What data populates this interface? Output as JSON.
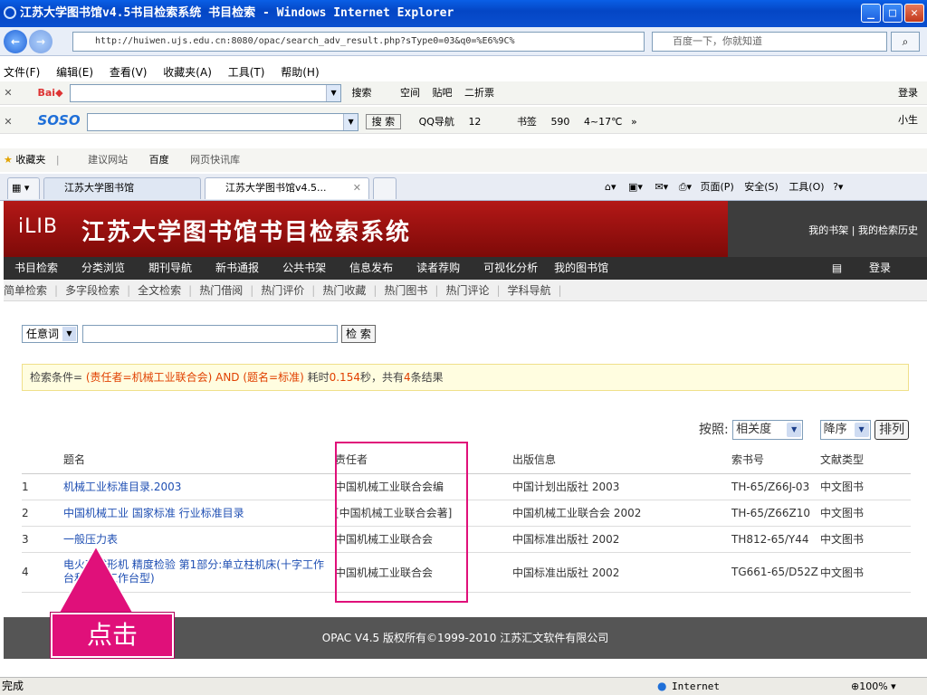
{
  "window": {
    "title": "江苏大学图书馆v4.5书目检索系统 书目检索 - Windows Internet Explorer",
    "minimize": "_",
    "maximize": "□",
    "close": "✕"
  },
  "address_bar": {
    "url": "http://huiwen.ujs.edu.cn:8080/opac/search_adv_result.php?sType0=03&q0=%E6%9C%",
    "search_placeholder": "百度一下，你就知道"
  },
  "menu": [
    "文件(F)",
    "编辑(E)",
    "查看(V)",
    "收藏夹(A)",
    "工具(T)",
    "帮助(H)"
  ],
  "baidu_toolbar": {
    "items": [
      "搜索",
      "空间",
      "贴吧",
      "二折票"
    ],
    "login": "登录"
  },
  "soso_toolbar": {
    "search": "搜 索",
    "items": [
      "QQ导航",
      "12",
      "书签",
      "590",
      "4~17℃",
      "»",
      "小生"
    ]
  },
  "favorites_bar": {
    "favorites": "收藏夹",
    "items": [
      "建议网站",
      "百度",
      "网页快讯库"
    ]
  },
  "tabs": [
    {
      "label": "江苏大学图书馆"
    },
    {
      "label": "江苏大学图书馆v4.5..."
    }
  ],
  "command_bar": [
    "页面(P)",
    "安全(S)",
    "工具(O)"
  ],
  "library": {
    "logo": "iLIB",
    "system_title": "江苏大学图书馆书目检索系统",
    "top_links": "我的书架 | 我的检索历史",
    "main_nav": [
      "书目检索",
      "分类浏览",
      "期刊导航",
      "新书通报",
      "公共书架",
      "信息发布",
      "读者荐购",
      "可视化分析",
      "我的图书馆"
    ],
    "login": "登录",
    "sub_nav": [
      "简单检索",
      "多字段检索",
      "全文检索",
      "热门借阅",
      "热门评价",
      "热门收藏",
      "热门图书",
      "热门评论",
      "学科导航"
    ],
    "search": {
      "field": "任意词",
      "button": "检 索"
    },
    "condition": {
      "prefix": "检索条件= ",
      "criteria": "(责任者=机械工业联合会) AND (题名=标准)",
      "time_label": "  耗时",
      "time": "0.154",
      "time_unit": "秒，共有",
      "count": "4",
      "suffix": "条结果"
    },
    "sort": {
      "label": "按照:",
      "field": "相关度",
      "order": "降序",
      "button": "排列"
    },
    "table": {
      "headers": [
        "",
        "题名",
        "责任者",
        "出版信息",
        "索书号",
        "文献类型"
      ],
      "rows": [
        [
          "1",
          "机械工业标准目录.2003",
          "中国机械工业联合会编",
          "中国计划出版社 2003",
          "TH-65/Z66J-03",
          "中文图书"
        ],
        [
          "2",
          "中国机械工业 国家标准 行业标准目录",
          "[中国机械工业联合会著]",
          "中国机械工业联合会 2002",
          "TH-65/Z66Z10",
          "中文图书"
        ],
        [
          "3",
          "一般压力表",
          "中国机械工业联合会",
          "中国标准出版社 2002",
          "TH812-65/Y44",
          "中文图书"
        ],
        [
          "4",
          "电火花成形机 精度检验 第1部分:单立柱机床(十字工作台和固定工作台型)",
          "中国机械工业联合会",
          "中国标准出版社 2002",
          "TG661-65/D52Z",
          "中文图书"
        ]
      ]
    },
    "footer": "OPAC V4.5   版权所有©1999-2010 江苏汇文软件有限公司"
  },
  "annotation": {
    "callout": "点击",
    "colors": {
      "accent": "#e0107a"
    }
  },
  "status_bar": {
    "status": "完成",
    "zone": "Internet",
    "zoom": "100%"
  }
}
